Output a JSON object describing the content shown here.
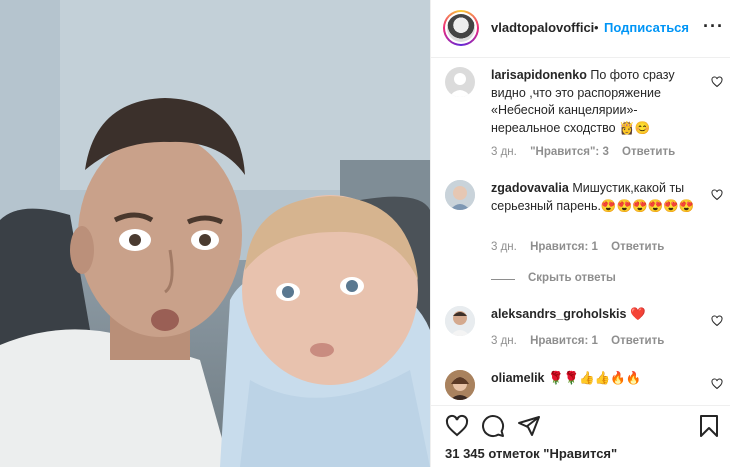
{
  "header": {
    "username": "vladtopalovoffici",
    "dot": "•",
    "follow_label": "Подписаться",
    "more_label": "···"
  },
  "comments": [
    {
      "user": "larisapidonenko",
      "text": "По фото сразу видно ,что это распоряжение «Небесной канцелярии»- нереальное сходство 👸😊",
      "age": "3 дн.",
      "likes_label": "\"Нравится\": 3",
      "reply_label": "Ответить"
    },
    {
      "user": "zgadovavalia",
      "text": "Мишустик,какой ты серьезный парень.😍😍😍😍😍😍",
      "age": "3 дн.",
      "likes_label": "Нравится: 1",
      "reply_label": "Ответить"
    },
    {
      "user": "aleksandrs_groholskis",
      "text": "❤️",
      "age": "3 дн.",
      "likes_label": "Нравится: 1",
      "reply_label": "Ответить"
    },
    {
      "user": "oliamelik",
      "text": "🌹🌹👍👍🔥🔥",
      "age": "",
      "likes_label": "",
      "reply_label": ""
    }
  ],
  "hide_replies_label": "Скрыть ответы",
  "likes_count_label": "31 345 отметок \"Нравится\"",
  "icons": [
    "heart-icon",
    "comment-icon",
    "share-icon",
    "bookmark-icon",
    "more-icon"
  ],
  "colors": {
    "follow": "#0095f6",
    "meta": "#8e8e8e",
    "text": "#262626"
  }
}
